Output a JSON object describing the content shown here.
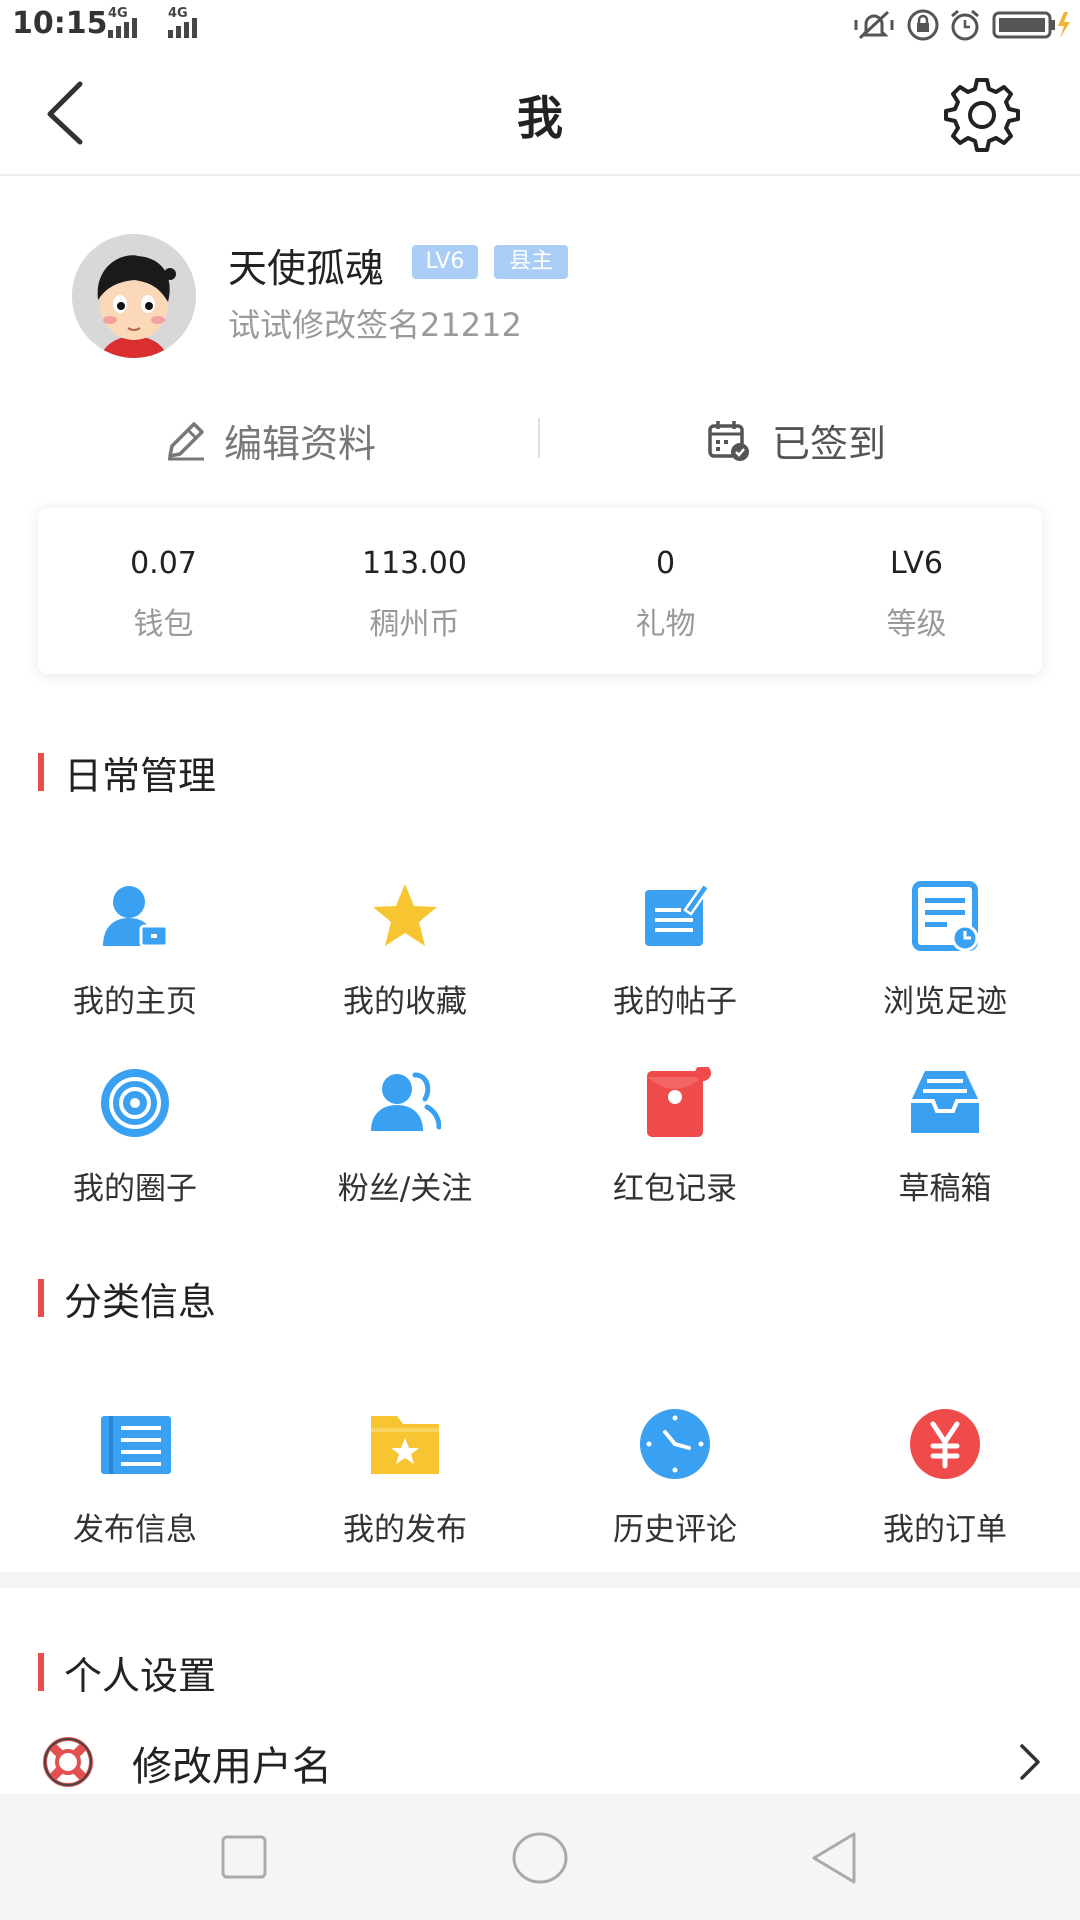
{
  "status_bar": {
    "time": "10:15",
    "network1": "4G",
    "network2": "4G"
  },
  "header": {
    "title": "我"
  },
  "profile": {
    "username": "天使孤魂",
    "level_badge": "LV6",
    "role_badge": "县主",
    "signature": "试试修改签名21212"
  },
  "actions": {
    "edit_label": "编辑资料",
    "checkin_label": "已签到"
  },
  "stats": [
    {
      "value": "0.07",
      "label": "钱包"
    },
    {
      "value": "113.00",
      "label": "稠州币"
    },
    {
      "value": "0",
      "label": "礼物"
    },
    {
      "value": "LV6",
      "label": "等级"
    }
  ],
  "daily": {
    "title": "日常管理",
    "items": [
      {
        "label": "我的主页",
        "icon": "user-home-icon"
      },
      {
        "label": "我的收藏",
        "icon": "star-icon"
      },
      {
        "label": "我的帖子",
        "icon": "post-edit-icon"
      },
      {
        "label": "浏览足迹",
        "icon": "history-doc-icon"
      },
      {
        "label": "我的圈子",
        "icon": "circle-icon"
      },
      {
        "label": "粉丝/关注",
        "icon": "fans-icon"
      },
      {
        "label": "红包记录",
        "icon": "red-packet-icon"
      },
      {
        "label": "草稿箱",
        "icon": "inbox-tray-icon"
      }
    ]
  },
  "classified": {
    "title": "分类信息",
    "items": [
      {
        "label": "发布信息",
        "icon": "publish-list-icon"
      },
      {
        "label": "我的发布",
        "icon": "folder-star-icon"
      },
      {
        "label": "历史评论",
        "icon": "clock-icon"
      },
      {
        "label": "我的订单",
        "icon": "yen-icon"
      }
    ]
  },
  "personal": {
    "title": "个人设置",
    "rows": [
      {
        "label": "修改用户名",
        "icon": "lifebuoy-icon"
      }
    ]
  },
  "colors": {
    "accent_red": "#e84c4c",
    "icon_blue": "#3aa0f2",
    "icon_yellow": "#f7c531",
    "badge_blue": "#a9cdf4"
  }
}
